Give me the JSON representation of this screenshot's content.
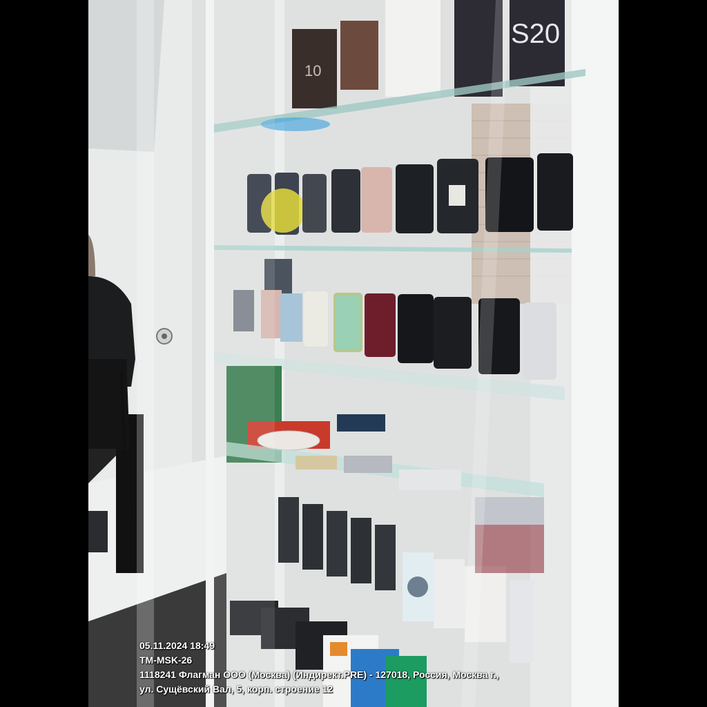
{
  "photo": {
    "subject": "glass display cabinet with smartphones and accessories",
    "box_labels": [
      "10",
      "S20"
    ]
  },
  "stamp": {
    "datetime": "05.11.2024 18:49",
    "store_code": "TM-MSK-26",
    "company_line": "1118241 Флагман ООО (Москва) (Индирект.PRE) - 127018, Россия, Москва г.,",
    "address_line": "ул. Сущёвский Вал, 5, корп. строение 12"
  },
  "colors": {
    "letterbox": "#000000",
    "wall": "#e6e8e6",
    "brick": "#c9b9aa",
    "glass_frame": "#eef0ef",
    "stamp_text": "#ffffff"
  }
}
